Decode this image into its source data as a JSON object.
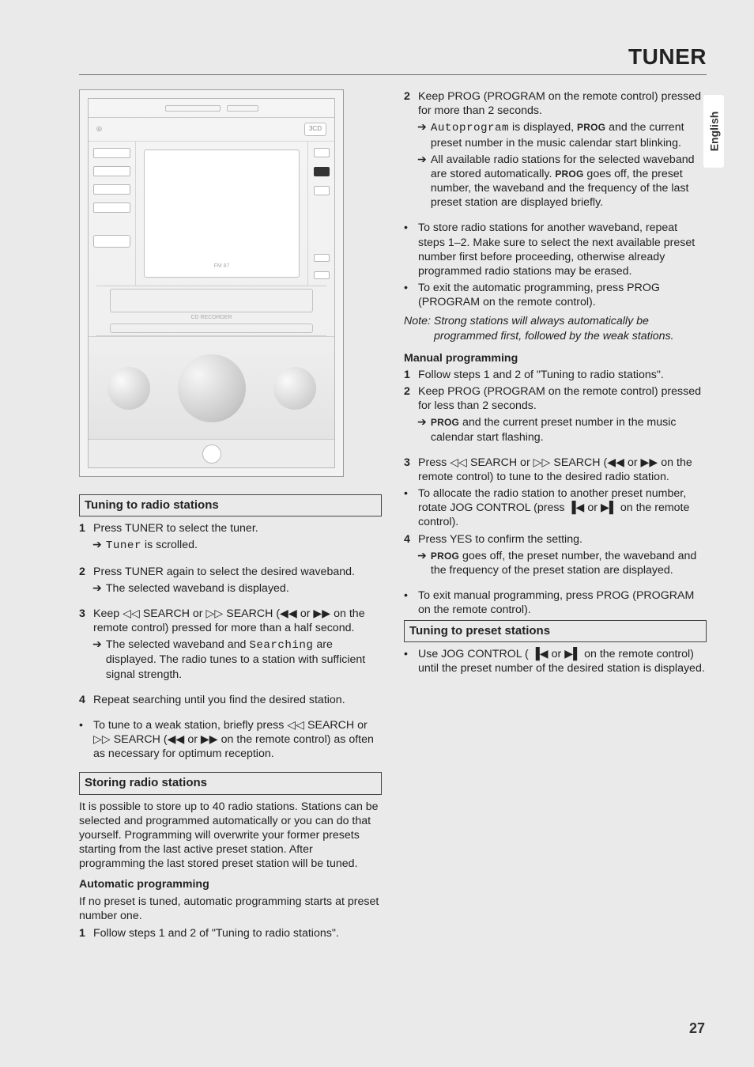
{
  "header": {
    "title": "TUNER"
  },
  "lang_tab": "English",
  "page_number": "27",
  "illustration": {
    "desc": "Front panel of a 3-CD hi-fi audio system with CD recorder deck, display and jog controls",
    "badge": "3CD",
    "band_label": "FM 87",
    "recorder_label": "CD RECORDER"
  },
  "left": {
    "tuning": {
      "title": "Tuning to radio stations",
      "s1_n": "1",
      "s1_t": "Press TUNER to select the tuner.",
      "s1_sub_a": "Tuner",
      "s1_sub_b": " is scrolled.",
      "s2_n": "2",
      "s2_t": "Press TUNER again to select the desired waveband.",
      "s2_sub": "The selected waveband is displayed.",
      "s3_n": "3",
      "s3_t_a": "Keep ",
      "s3_t_b": " SEARCH or ",
      "s3_t_c": " SEARCH (",
      "s3_t_d": " or ",
      "s3_t_e": " on the remote control) pressed for more than a half second.",
      "s3_sub_a": "The selected waveband and ",
      "s3_sub_b": "Searching",
      "s3_sub_c": " are displayed. The radio tunes to a station with sufficient signal strength.",
      "s4_n": "4",
      "s4_t": "Repeat searching until you find the desired station.",
      "bullet_a": "To tune to a weak station, briefly press ",
      "bullet_b": " SEARCH or ",
      "bullet_c": " SEARCH (",
      "bullet_d": " or ",
      "bullet_e": " on the remote control) as often as necessary for optimum reception."
    },
    "storing": {
      "title": "Storing radio stations",
      "intro": "It is possible to store up to 40 radio stations. Stations can be selected and programmed automatically or you can do that yourself. Programming will overwrite your former presets starting from the last active preset station. After programming the last stored preset station will be tuned.",
      "auto_head": "Automatic programming",
      "auto_intro": "If no preset is tuned, automatic programming starts at preset number one.",
      "auto_s1_n": "1",
      "auto_s1_t": "Follow steps 1 and 2 of \"Tuning to radio stations\"."
    }
  },
  "right": {
    "auto": {
      "s2_n": "2",
      "s2_t": "Keep PROG (PROGRAM on the remote control) pressed for more than 2 seconds.",
      "s2_sub1_a": "Autoprogram",
      "s2_sub1_b": " is displayed, ",
      "s2_sub1_c": "PROG",
      "s2_sub1_d": " and the current preset number in the music calendar start blinking.",
      "s2_sub2_a": "All available radio stations for the selected waveband are stored automatically. ",
      "s2_sub2_b": "PROG",
      "s2_sub2_c": " goes off, the preset number, the waveband and the frequency of the last preset station are displayed briefly.",
      "b1": "To store radio stations for another waveband, repeat steps 1–2. Make sure to select the next available preset number first before proceeding, otherwise already programmed radio stations may be erased.",
      "b2": "To exit the automatic programming, press PROG (PROGRAM on the remote control).",
      "note1": "Note: Strong stations will always automatically be",
      "note2": "programmed first, followed by the weak stations."
    },
    "manual": {
      "head": "Manual programming",
      "s1_n": "1",
      "s1_t": "Follow steps 1 and 2 of \"Tuning to radio stations\".",
      "s2_n": "2",
      "s2_t": "Keep PROG (PROGRAM on the remote control) pressed for less than 2 seconds.",
      "s2_sub_a": "PROG",
      "s2_sub_b": " and the current preset number in the music calendar start flashing.",
      "s3_n": "3",
      "s3_t_a": "Press ",
      "s3_t_b": " SEARCH or ",
      "s3_t_c": " SEARCH (",
      "s3_t_d": " or ",
      "s3_t_e": " on the remote control) to tune to the desired radio station.",
      "b1_a": "To allocate the radio station to another preset number, rotate JOG CONTROL (press ",
      "b1_b": " or ",
      "b1_c": " on the remote control).",
      "s4_n": "4",
      "s4_t": "Press YES to confirm the setting.",
      "s4_sub_a": "PROG",
      "s4_sub_b": " goes off, the preset number, the waveband and the frequency of the preset station are displayed.",
      "b2": "To exit manual programming, press PROG (PROGRAM on the remote control)."
    },
    "preset": {
      "title": "Tuning to preset stations",
      "b_a": "Use JOG CONTROL ( ",
      "b_b": " or ",
      "b_c": " on the remote control) until the preset number of the desired station is displayed."
    }
  },
  "sym": {
    "rwd_outline": "◁◁",
    "fwd_outline": "▷▷",
    "rwd_solid": "◀◀",
    "fwd_solid": "▶▶",
    "prev": "▐◀",
    "next": "▶▌",
    "arrow": "➔"
  }
}
